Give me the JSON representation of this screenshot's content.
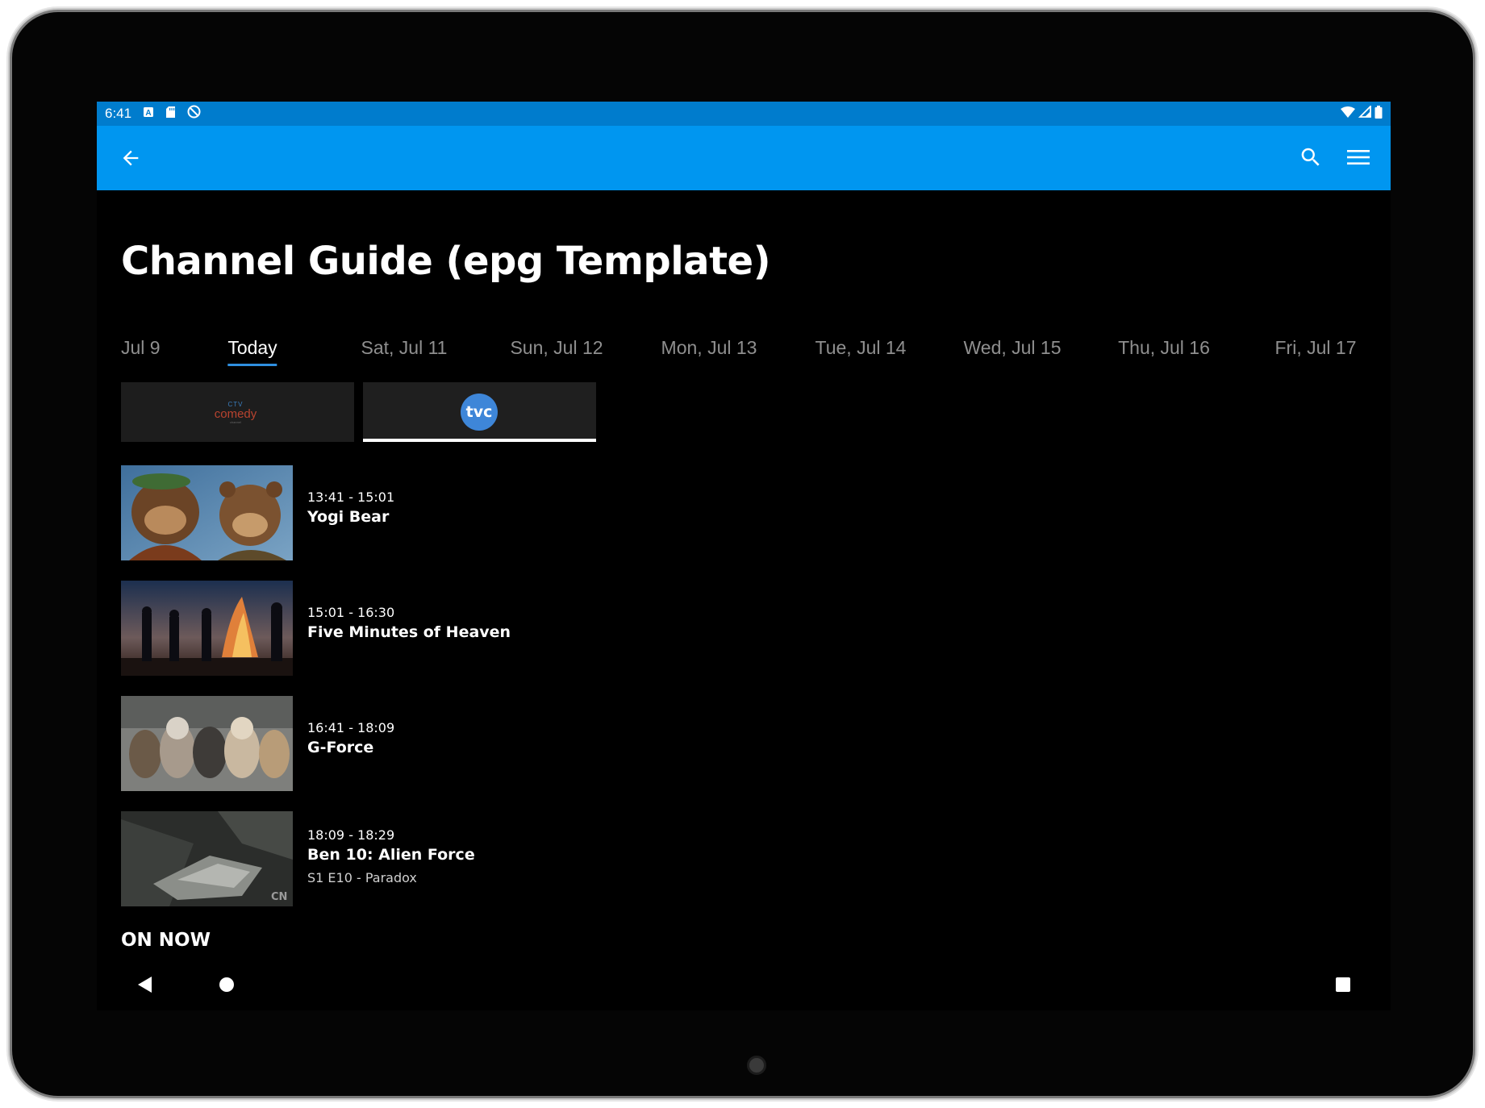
{
  "status_bar": {
    "time": "6:41",
    "left_icons": [
      "notification-a-icon",
      "sd-card-icon",
      "data-saver-icon"
    ],
    "right_icons": [
      "wifi-icon",
      "cell-signal-icon",
      "battery-icon"
    ]
  },
  "app_bar": {
    "background": "#0096f0",
    "actions": [
      "back-arrow-icon",
      "search-icon",
      "menu-icon"
    ]
  },
  "page": {
    "title": "Channel Guide (epg Template)"
  },
  "date_tabs": [
    {
      "label": "Jul 9",
      "active": false
    },
    {
      "label": "Today",
      "active": true
    },
    {
      "label": "Sat, Jul 11",
      "active": false
    },
    {
      "label": "Sun, Jul 12",
      "active": false
    },
    {
      "label": "Mon, Jul 13",
      "active": false
    },
    {
      "label": "Tue, Jul 14",
      "active": false
    },
    {
      "label": "Wed, Jul 15",
      "active": false
    },
    {
      "label": "Thu, Jul 16",
      "active": false
    },
    {
      "label": "Fri, Jul 17",
      "active": false
    }
  ],
  "channels": [
    {
      "logo": {
        "top": "CTV",
        "mid": "comedy",
        "bot": "channel"
      },
      "selected": false
    },
    {
      "logo_text": "tvc",
      "selected": true
    }
  ],
  "programs": [
    {
      "time": "13:41 - 15:01",
      "title": "Yogi Bear",
      "subtitle": ""
    },
    {
      "time": "15:01 - 16:30",
      "title": "Five Minutes of Heaven",
      "subtitle": ""
    },
    {
      "time": "16:41 - 18:09",
      "title": "G-Force",
      "subtitle": ""
    },
    {
      "time": "18:09 - 18:29",
      "title": "Ben 10: Alien Force",
      "subtitle": "S1 E10 - Paradox"
    }
  ],
  "thumbnail_badge": "CN",
  "section": {
    "on_now": "ON NOW"
  },
  "nav_bar": [
    "nav-back-icon",
    "nav-home-icon",
    "nav-recents-icon"
  ],
  "colors": {
    "status_bar": "#007ccd",
    "app_bar": "#0096f0",
    "active_tab_underline": "#2f8fe0",
    "tvc_logo": "#3e86d8",
    "background": "#000000"
  }
}
